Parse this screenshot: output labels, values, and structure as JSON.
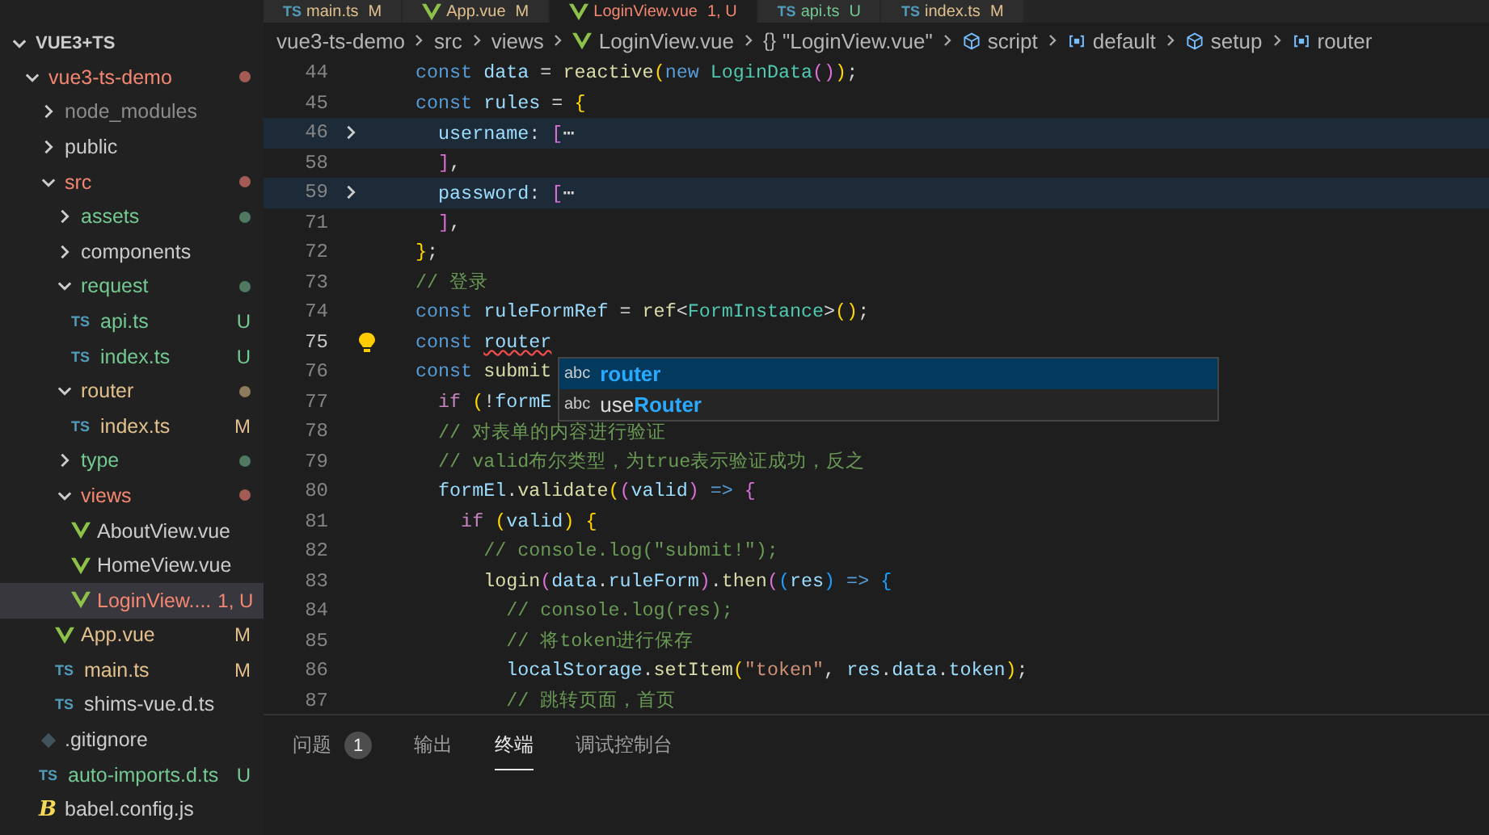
{
  "explorer": {
    "title": "VUE3+TS",
    "items": [
      {
        "name": "vue3-ts-demo",
        "kind": "folder",
        "expanded": true,
        "color": "#f48771",
        "dot": {
          "color": "#a35c55"
        },
        "selected": false,
        "children": [
          {
            "name": "node_modules",
            "kind": "folder",
            "expanded": false,
            "color": "#8c8c8c",
            "selected": false
          },
          {
            "name": "public",
            "kind": "folder",
            "expanded": false,
            "color": "#cccccc",
            "selected": false
          },
          {
            "name": "src",
            "kind": "folder",
            "expanded": true,
            "color": "#f48771",
            "dot": {
              "color": "#a35c55"
            },
            "selected": false,
            "children": [
              {
                "name": "assets",
                "kind": "folder",
                "expanded": false,
                "color": "#73c991",
                "dot": {
                  "color": "#4f7a61"
                },
                "selected": false
              },
              {
                "name": "components",
                "kind": "folder",
                "expanded": false,
                "color": "#cccccc",
                "selected": false
              },
              {
                "name": "request",
                "kind": "folder",
                "expanded": true,
                "color": "#73c991",
                "dot": {
                  "color": "#4f7a61"
                },
                "selected": false,
                "children": [
                  {
                    "name": "api.ts",
                    "kind": "ts",
                    "icon_text": "TS",
                    "badge": "U",
                    "color": "#73c991",
                    "selected": false
                  },
                  {
                    "name": "index.ts",
                    "kind": "ts",
                    "icon_text": "TS",
                    "badge": "U",
                    "color": "#73c991",
                    "selected": false
                  }
                ]
              },
              {
                "name": "router",
                "kind": "folder",
                "expanded": true,
                "color": "#e2c08d",
                "dot": {
                  "color": "#8e7a5c"
                },
                "selected": false,
                "children": [
                  {
                    "name": "index.ts",
                    "kind": "ts",
                    "icon_text": "TS",
                    "badge": "M",
                    "color": "#e2c08d",
                    "selected": false
                  }
                ]
              },
              {
                "name": "type",
                "kind": "folder",
                "expanded": false,
                "color": "#73c991",
                "dot": {
                  "color": "#4f7a61"
                },
                "selected": false
              },
              {
                "name": "views",
                "kind": "folder",
                "expanded": true,
                "color": "#f48771",
                "dot": {
                  "color": "#a35c55"
                },
                "selected": false,
                "children": [
                  {
                    "name": "AboutView.vue",
                    "kind": "vue",
                    "color": "#cccccc",
                    "selected": false
                  },
                  {
                    "name": "HomeView.vue",
                    "kind": "vue",
                    "color": "#cccccc",
                    "selected": false
                  },
                  {
                    "name": "LoginView....",
                    "kind": "vue",
                    "badge": "1, U",
                    "color": "#f48771",
                    "selected": true
                  }
                ]
              },
              {
                "name": "App.vue",
                "kind": "vue",
                "badge": "M",
                "color": "#e2c08d",
                "selected": false
              },
              {
                "name": "main.ts",
                "kind": "ts",
                "icon_text": "TS",
                "badge": "M",
                "color": "#e2c08d",
                "selected": false
              },
              {
                "name": "shims-vue.d.ts",
                "kind": "ts",
                "icon_text": "TS",
                "color": "#cccccc",
                "selected": false
              }
            ]
          },
          {
            "name": ".gitignore",
            "kind": "git",
            "color": "#cccccc",
            "selected": false
          },
          {
            "name": "auto-imports.d.ts",
            "kind": "ts",
            "icon_text": "TS",
            "badge": "U",
            "color": "#73c991",
            "selected": false
          },
          {
            "name": "babel.config.js",
            "kind": "babel",
            "icon_text": "B",
            "color": "#cccccc",
            "selected": false
          }
        ]
      }
    ]
  },
  "tabs": [
    {
      "label": "main.ts",
      "kind": "ts",
      "icon_text": "TS",
      "badge": "M",
      "color": "#e2c08d",
      "selected": false
    },
    {
      "label": "App.vue",
      "kind": "vue",
      "badge": "M",
      "color": "#e2c08d",
      "selected": false
    },
    {
      "label": "LoginView.vue",
      "kind": "vue",
      "badge": "1, U",
      "color": "#f48771",
      "selected": true
    },
    {
      "label": "api.ts",
      "kind": "ts",
      "icon_text": "TS",
      "badge": "U",
      "color": "#73c991",
      "selected": false
    },
    {
      "label": "index.ts",
      "kind": "ts",
      "icon_text": "TS",
      "badge": "M",
      "color": "#e2c08d",
      "selected": false
    }
  ],
  "breadcrumb": [
    {
      "label": "vue3-ts-demo",
      "kind": "folder"
    },
    {
      "label": "src",
      "kind": "folder"
    },
    {
      "label": "views",
      "kind": "folder"
    },
    {
      "label": "LoginView.vue",
      "kind": "vue"
    },
    {
      "label": "\"LoginView.vue\"",
      "kind": "braces",
      "icon_text": "{}"
    },
    {
      "label": "script",
      "kind": "cube"
    },
    {
      "label": "default",
      "kind": "field"
    },
    {
      "label": "setup",
      "kind": "cube"
    },
    {
      "label": "router",
      "kind": "field"
    }
  ],
  "code": [
    {
      "num": "44",
      "folded": false,
      "current": false,
      "tokens": [
        {
          "t": "const",
          "kind": "kw"
        },
        {
          "t": " data",
          "kind": "var"
        },
        {
          "t": " = ",
          "kind": "p"
        },
        {
          "t": "reactive",
          "kind": "fn"
        },
        {
          "t": "(",
          "kind": "b1"
        },
        {
          "t": "new",
          "kind": "kw"
        },
        {
          "t": " LoginData",
          "kind": "type"
        },
        {
          "t": "()",
          "kind": "b2"
        },
        {
          "t": ")",
          "kind": "b1"
        },
        {
          "t": ";",
          "kind": "p"
        }
      ]
    },
    {
      "num": "45",
      "folded": false,
      "current": false,
      "tokens": [
        {
          "t": "const",
          "kind": "kw"
        },
        {
          "t": " rules",
          "kind": "var"
        },
        {
          "t": " = ",
          "kind": "p"
        },
        {
          "t": "{",
          "kind": "b1"
        }
      ]
    },
    {
      "num": "46",
      "folded": true,
      "current": false,
      "tokens": [
        {
          "t": "  username",
          "kind": "var"
        },
        {
          "t": ": ",
          "kind": "p"
        },
        {
          "t": "[",
          "kind": "b2"
        },
        {
          "t": "⋯",
          "kind": "p"
        }
      ]
    },
    {
      "num": "58",
      "folded": false,
      "current": false,
      "tokens": [
        {
          "t": "  ]",
          "kind": "b2"
        },
        {
          "t": ",",
          "kind": "p"
        }
      ]
    },
    {
      "num": "59",
      "folded": true,
      "current": false,
      "tokens": [
        {
          "t": "  password",
          "kind": "var"
        },
        {
          "t": ": ",
          "kind": "p"
        },
        {
          "t": "[",
          "kind": "b2"
        },
        {
          "t": "⋯",
          "kind": "p"
        }
      ]
    },
    {
      "num": "71",
      "folded": false,
      "current": false,
      "tokens": [
        {
          "t": "  ]",
          "kind": "b2"
        },
        {
          "t": ",",
          "kind": "p"
        }
      ]
    },
    {
      "num": "72",
      "folded": false,
      "current": false,
      "tokens": [
        {
          "t": "}",
          "kind": "b1"
        },
        {
          "t": ";",
          "kind": "p"
        }
      ]
    },
    {
      "num": "73",
      "folded": false,
      "current": false,
      "tokens": [
        {
          "t": "// 登录",
          "kind": "cm"
        }
      ]
    },
    {
      "num": "74",
      "folded": false,
      "current": false,
      "tokens": [
        {
          "t": "const",
          "kind": "kw"
        },
        {
          "t": " ruleFormRef",
          "kind": "var"
        },
        {
          "t": " = ",
          "kind": "p"
        },
        {
          "t": "ref",
          "kind": "fn"
        },
        {
          "t": "<",
          "kind": "p"
        },
        {
          "t": "FormInstance",
          "kind": "type"
        },
        {
          "t": ">",
          "kind": "p"
        },
        {
          "t": "()",
          "kind": "b1"
        },
        {
          "t": ";",
          "kind": "p"
        }
      ]
    },
    {
      "num": "75",
      "folded": false,
      "current": true,
      "tokens": [
        {
          "t": "const ",
          "kind": "kw"
        },
        {
          "t": "router",
          "kind": "err"
        }
      ]
    },
    {
      "num": "76",
      "folded": false,
      "current": false,
      "tokens": [
        {
          "t": "const",
          "kind": "kw"
        },
        {
          "t": " submit",
          "kind": "fn"
        }
      ]
    },
    {
      "num": "77",
      "folded": false,
      "current": false,
      "tokens": [
        {
          "t": "  if ",
          "kind": "ctl"
        },
        {
          "t": "(",
          "kind": "b1"
        },
        {
          "t": "!",
          "kind": "p"
        },
        {
          "t": "formE",
          "kind": "var"
        }
      ]
    },
    {
      "num": "78",
      "folded": false,
      "current": false,
      "tokens": [
        {
          "t": "  // 对表单的内容进行验证",
          "kind": "cm"
        }
      ]
    },
    {
      "num": "79",
      "folded": false,
      "current": false,
      "tokens": [
        {
          "t": "  // valid布尔类型，为true表示验证成功，反之",
          "kind": "cm"
        }
      ]
    },
    {
      "num": "80",
      "folded": false,
      "current": false,
      "tokens": [
        {
          "t": "  formEl",
          "kind": "var"
        },
        {
          "t": ".",
          "kind": "p"
        },
        {
          "t": "validate",
          "kind": "fn"
        },
        {
          "t": "(",
          "kind": "b1"
        },
        {
          "t": "(",
          "kind": "b2"
        },
        {
          "t": "valid",
          "kind": "var"
        },
        {
          "t": ")",
          "kind": "b2"
        },
        {
          "t": " => ",
          "kind": "kw"
        },
        {
          "t": "{",
          "kind": "b2"
        }
      ]
    },
    {
      "num": "81",
      "folded": false,
      "current": false,
      "tokens": [
        {
          "t": "    if ",
          "kind": "ctl"
        },
        {
          "t": "(",
          "kind": "b1"
        },
        {
          "t": "valid",
          "kind": "var"
        },
        {
          "t": ")",
          "kind": "b1"
        },
        {
          "t": " {",
          "kind": "b1"
        }
      ]
    },
    {
      "num": "82",
      "folded": false,
      "current": false,
      "tokens": [
        {
          "t": "      // console.log(\"submit!\");",
          "kind": "cm"
        }
      ]
    },
    {
      "num": "83",
      "folded": false,
      "current": false,
      "tokens": [
        {
          "t": "      login",
          "kind": "fn"
        },
        {
          "t": "(",
          "kind": "b2"
        },
        {
          "t": "data",
          "kind": "var"
        },
        {
          "t": ".",
          "kind": "p"
        },
        {
          "t": "ruleForm",
          "kind": "var"
        },
        {
          "t": ")",
          "kind": "b2"
        },
        {
          "t": ".",
          "kind": "p"
        },
        {
          "t": "then",
          "kind": "fn"
        },
        {
          "t": "(",
          "kind": "b2"
        },
        {
          "t": "(",
          "kind": "b3"
        },
        {
          "t": "res",
          "kind": "var"
        },
        {
          "t": ")",
          "kind": "b3"
        },
        {
          "t": " => ",
          "kind": "kw"
        },
        {
          "t": "{",
          "kind": "b3"
        }
      ]
    },
    {
      "num": "84",
      "folded": false,
      "current": false,
      "tokens": [
        {
          "t": "        // console.log(res);",
          "kind": "cm"
        }
      ]
    },
    {
      "num": "85",
      "folded": false,
      "current": false,
      "tokens": [
        {
          "t": "        // 将token进行保存",
          "kind": "cm"
        }
      ]
    },
    {
      "num": "86",
      "folded": false,
      "current": false,
      "tokens": [
        {
          "t": "        localStorage",
          "kind": "var"
        },
        {
          "t": ".",
          "kind": "p"
        },
        {
          "t": "setItem",
          "kind": "fn"
        },
        {
          "t": "(",
          "kind": "b1"
        },
        {
          "t": "\"token\"",
          "kind": "str"
        },
        {
          "t": ", ",
          "kind": "p"
        },
        {
          "t": "res",
          "kind": "var"
        },
        {
          "t": ".",
          "kind": "p"
        },
        {
          "t": "data",
          "kind": "var"
        },
        {
          "t": ".",
          "kind": "p"
        },
        {
          "t": "token",
          "kind": "var"
        },
        {
          "t": ")",
          "kind": "b1"
        },
        {
          "t": ";",
          "kind": "p"
        }
      ]
    },
    {
      "num": "87",
      "folded": false,
      "current": false,
      "tokens": [
        {
          "t": "        // 跳转页面，首页",
          "kind": "cm"
        }
      ]
    }
  ],
  "suggestions": [
    {
      "icon_text": "abc",
      "match": "router",
      "selected": true
    },
    {
      "icon_text": "abc",
      "before": "use",
      "match": "Router",
      "selected": false
    }
  ],
  "panel_tabs": [
    {
      "label": "问题",
      "count": "1",
      "selected": false
    },
    {
      "label": "输出",
      "selected": false
    },
    {
      "label": "终端",
      "selected": true
    },
    {
      "label": "调试控制台",
      "selected": false
    }
  ]
}
